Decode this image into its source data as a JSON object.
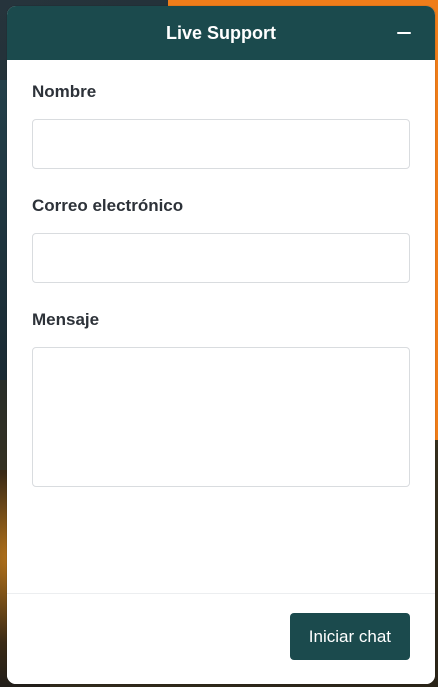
{
  "header": {
    "title": "Live Support",
    "minimize_icon": "minus-icon"
  },
  "form": {
    "name_label": "Nombre",
    "name_value": "",
    "email_label": "Correo electrónico",
    "email_value": "",
    "message_label": "Mensaje",
    "message_value": ""
  },
  "footer": {
    "start_chat_label": "Iniciar chat"
  },
  "colors": {
    "brand": "#1b4a4d",
    "background_accent": "#ef7d1a"
  }
}
